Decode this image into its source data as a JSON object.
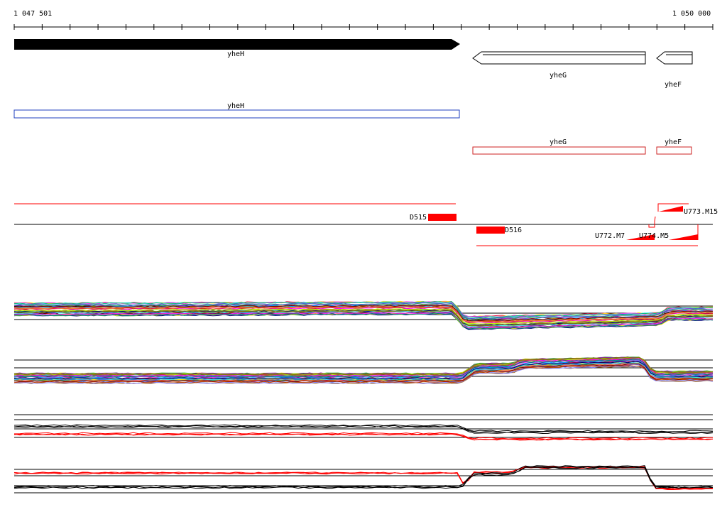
{
  "ruler": {
    "start_label": "1 047 501",
    "end_label": "1 050 000"
  },
  "genes_top": [
    {
      "name": "yheH",
      "strand": "+"
    },
    {
      "name": "yheG",
      "strand": "-"
    },
    {
      "name": "yheF",
      "strand": "-"
    }
  ],
  "annotations": [
    {
      "name": "yheH",
      "color": "#1f3fbf"
    },
    {
      "name": "yheG",
      "color": "#cc2222"
    },
    {
      "name": "yheF",
      "color": "#cc2222"
    }
  ],
  "segments": [
    {
      "name": "D515"
    },
    {
      "name": "D516"
    },
    {
      "name": "U773.M15"
    },
    {
      "name": "U772.M7"
    },
    {
      "name": "U774.M5"
    }
  ],
  "colors": {
    "arrow_fill": "#000000",
    "segment_red": "#ff0000",
    "annotation_blue": "#1f3fbf",
    "annotation_red": "#cc2222"
  },
  "profile_palette": [
    "#e6194b",
    "#3cb44b",
    "#ffe119",
    "#4363d8",
    "#f58231",
    "#911eb4",
    "#46f0f0",
    "#f032e6",
    "#bcf60c",
    "#008080",
    "#9a6324",
    "#800000",
    "#000075",
    "#808000",
    "#ff7fbf",
    "#7f7fff",
    "#00a0ff",
    "#ff00ff",
    "#00c080",
    "#c04000"
  ]
}
